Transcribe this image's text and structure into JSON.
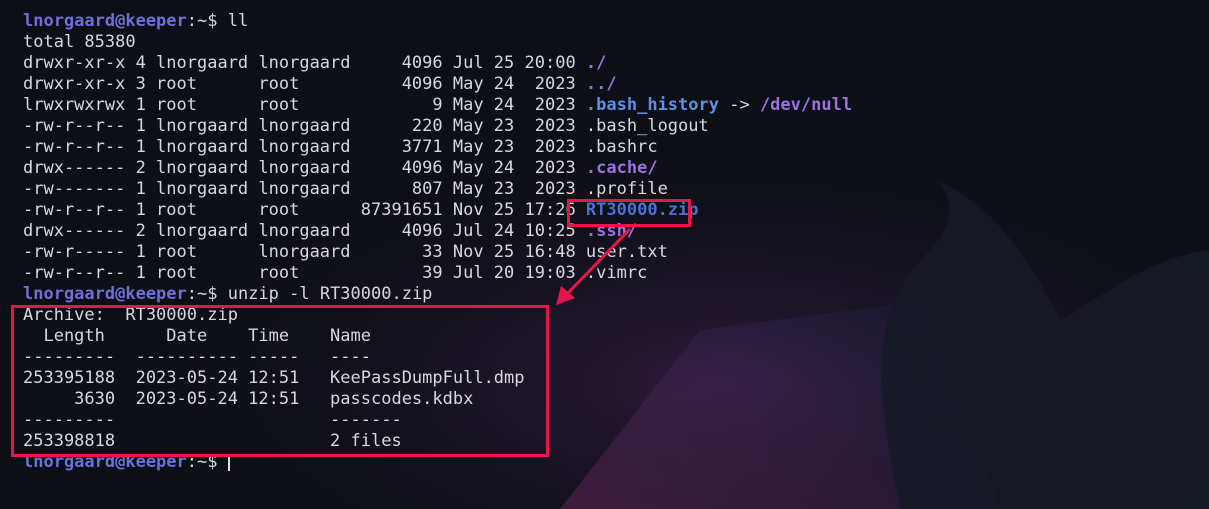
{
  "colors": {
    "highlight": "#e8154a",
    "user": "#6f6fd8",
    "dir": "#9b73e0",
    "link": "#5f8fe0"
  },
  "prompt": {
    "user": "lnorgaard@keeper",
    "path": ":~$ "
  },
  "cmd1": "ll",
  "total": "total 85380",
  "listing": [
    {
      "meta": "drwxr-xr-x 4 lnorgaard lnorgaard     4096 Jul 25 20:00 ",
      "name": "./",
      "kind": "dir"
    },
    {
      "meta": "drwxr-xr-x 3 root      root          4096 May 24  2023 ",
      "name": "../",
      "kind": "dir"
    },
    {
      "meta": "lrwxrwxrwx 1 root      root             9 May 24  2023 ",
      "name": ".bash_history",
      "kind": "link",
      "arrow": " -> ",
      "target": "/dev/null"
    },
    {
      "meta": "-rw-r--r-- 1 lnorgaard lnorgaard      220 May 23  2023 ",
      "name": ".bash_logout",
      "kind": "file"
    },
    {
      "meta": "-rw-r--r-- 1 lnorgaard lnorgaard     3771 May 23  2023 ",
      "name": ".bashrc",
      "kind": "file"
    },
    {
      "meta": "drwx------ 2 lnorgaard lnorgaard     4096 May 24  2023 ",
      "name": ".cache/",
      "kind": "dir"
    },
    {
      "meta": "-rw------- 1 lnorgaard lnorgaard      807 May 23  2023 ",
      "name": ".profile",
      "kind": "file"
    },
    {
      "meta": "-rw-r--r-- 1 root      root      87391651 Nov 25 17:26 ",
      "name": "RT30000.zip",
      "kind": "arch"
    },
    {
      "meta": "drwx------ 2 lnorgaard lnorgaard     4096 Jul 24 10:25 ",
      "name": ".ssh/",
      "kind": "dir"
    },
    {
      "meta": "-rw-r----- 1 root      lnorgaard       33 Nov 25 16:48 ",
      "name": "user.txt",
      "kind": "file"
    },
    {
      "meta": "-rw-r--r-- 1 root      root            39 Jul 20 19:03 ",
      "name": ".vimrc",
      "kind": "file"
    }
  ],
  "cmd2": "unzip -l RT30000.zip",
  "unzip_output": [
    "Archive:  RT30000.zip",
    "  Length      Date    Time    Name",
    "---------  ---------- -----   ----",
    "253395188  2023-05-24 12:51   KeePassDumpFull.dmp",
    "     3630  2023-05-24 12:51   passcodes.kdbx",
    "---------                     -------",
    "253398818                     2 files"
  ]
}
